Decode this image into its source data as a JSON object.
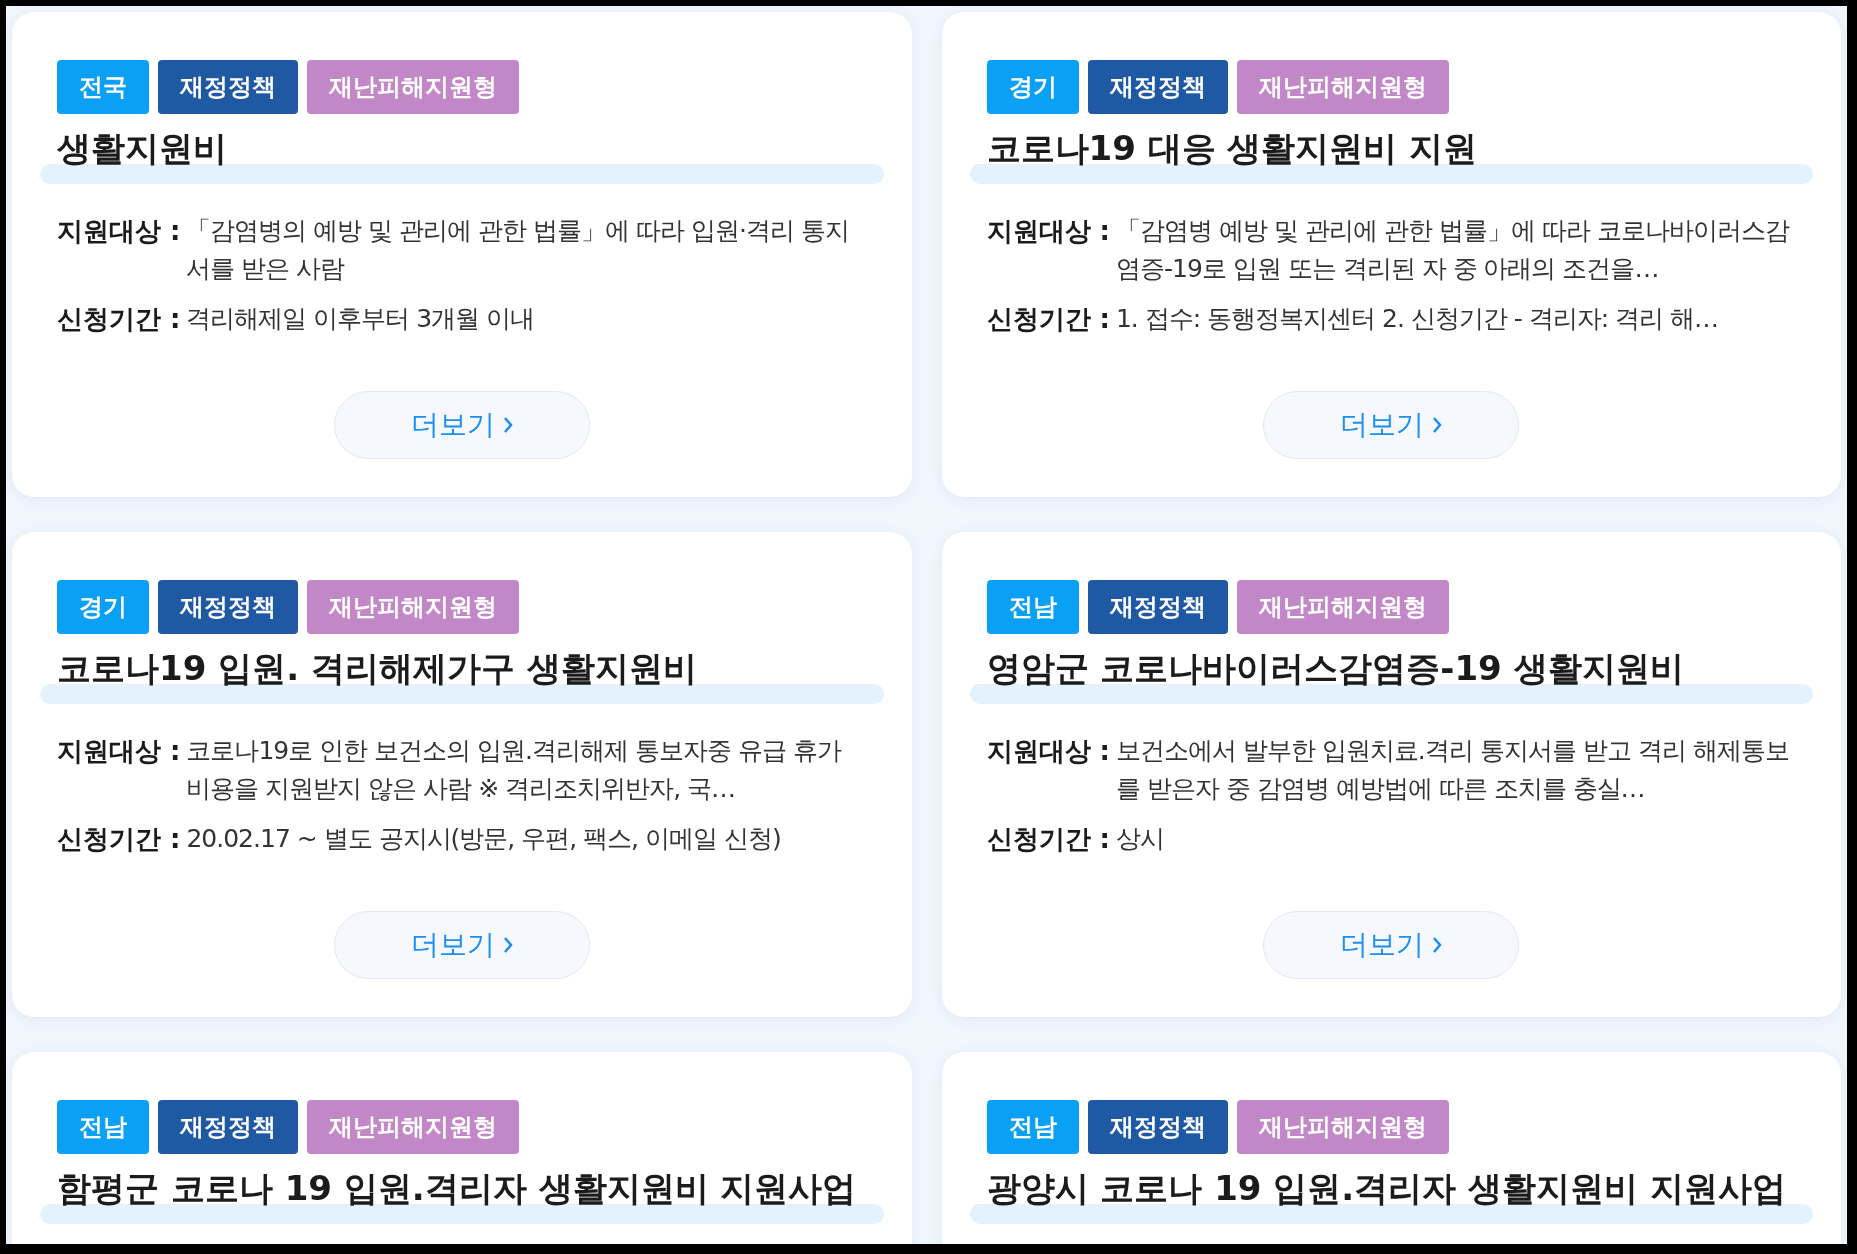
{
  "cards": [
    {
      "tags": [
        {
          "label": "전국",
          "kind": "region"
        },
        {
          "label": "재정정책",
          "kind": "category"
        },
        {
          "label": "재난피해지원형",
          "kind": "type"
        }
      ],
      "title": "생활지원비",
      "fields": [
        {
          "label": "지원대상 :",
          "value": "「감염병의 예방 및 관리에 관한 법률」에 따라 입원·격리 통지서를 받은 사람"
        },
        {
          "label": "신청기간 :",
          "value": "격리해제일 이후부터 3개월 이내"
        }
      ],
      "more": "더보기"
    },
    {
      "tags": [
        {
          "label": "경기",
          "kind": "region"
        },
        {
          "label": "재정정책",
          "kind": "category"
        },
        {
          "label": "재난피해지원형",
          "kind": "type"
        }
      ],
      "title": "코로나19 대응 생활지원비 지원",
      "fields": [
        {
          "label": "지원대상 :",
          "value": "「감염병 예방 및 관리에 관한 법률」에 따라 코로나바이러스감염증-19로 입원 또는 격리된 자 중 아래의 조건을…"
        },
        {
          "label": "신청기간 :",
          "value": "1. 접수: 동행정복지센터 2. 신청기간 - 격리자: 격리 해…"
        }
      ],
      "more": "더보기"
    },
    {
      "tags": [
        {
          "label": "경기",
          "kind": "region"
        },
        {
          "label": "재정정책",
          "kind": "category"
        },
        {
          "label": "재난피해지원형",
          "kind": "type"
        }
      ],
      "title": "코로나19 입원. 격리해제가구 생활지원비",
      "fields": [
        {
          "label": "지원대상 :",
          "value": "코로나19로 인한 보건소의 입원.격리해제 통보자중 유급 휴가비용을 지원받지 않은 사람 ※ 격리조치위반자, 국…"
        },
        {
          "label": "신청기간 :",
          "value": "20.02.17 ~ 별도 공지시(방문, 우편, 팩스, 이메일 신청)"
        }
      ],
      "more": "더보기"
    },
    {
      "tags": [
        {
          "label": "전남",
          "kind": "region"
        },
        {
          "label": "재정정책",
          "kind": "category"
        },
        {
          "label": "재난피해지원형",
          "kind": "type"
        }
      ],
      "title": "영암군 코로나바이러스감염증-19 생활지원비",
      "fields": [
        {
          "label": "지원대상 :",
          "value": "보건소에서 발부한 입원치료.격리 통지서를 받고 격리 해제통보를 받은자 중 감염병 예방법에 따른 조치를 충실…"
        },
        {
          "label": "신청기간 :",
          "value": "상시"
        }
      ],
      "more": "더보기"
    },
    {
      "tags": [
        {
          "label": "전남",
          "kind": "region"
        },
        {
          "label": "재정정책",
          "kind": "category"
        },
        {
          "label": "재난피해지원형",
          "kind": "type"
        }
      ],
      "title": "함평군 코로나 19 입원.격리자 생활지원비 지원사업"
    },
    {
      "tags": [
        {
          "label": "전남",
          "kind": "region"
        },
        {
          "label": "재정정책",
          "kind": "category"
        },
        {
          "label": "재난피해지원형",
          "kind": "type"
        }
      ],
      "title": "광양시 코로나 19 입원.격리자 생활지원비 지원사업"
    }
  ]
}
